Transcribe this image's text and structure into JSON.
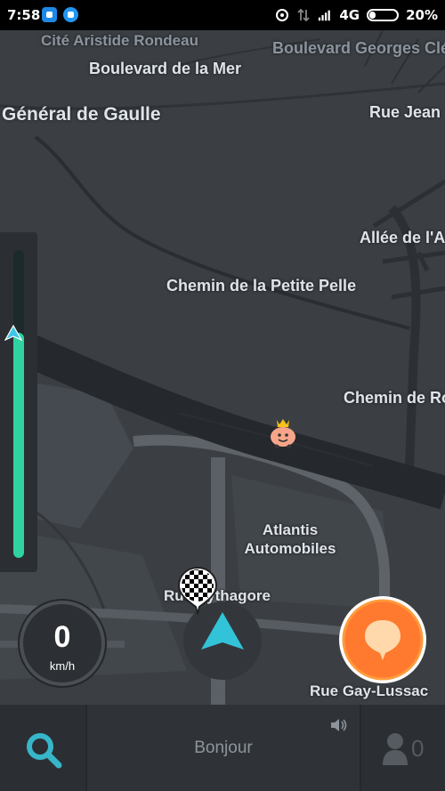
{
  "status_bar": {
    "time": "7:58",
    "network": "4G",
    "battery": "20%"
  },
  "map": {
    "street_labels": [
      "Cité Aristide Rondeau",
      "Boulevard Georges Clé",
      "Boulevard de la Mer",
      "Général de Gaulle",
      "Rue Jean",
      "Allée de l'A",
      "Chemin de la Petite Pelle",
      "Chemin de Ro",
      "Rue Pythagore",
      "Rue Gay-Lussac"
    ],
    "poi_label_line1": "Atlantis",
    "poi_label_line2": "Automobiles"
  },
  "progress": {
    "fraction": 0.27
  },
  "speedometer": {
    "value": "0",
    "unit": "km/h"
  },
  "bottom_bar": {
    "greeting": "Bonjour",
    "users_count": "0"
  },
  "colors": {
    "progress": "#2fd3a0",
    "report_button": "#ff7a2e",
    "search_icon": "#37b6c9"
  }
}
